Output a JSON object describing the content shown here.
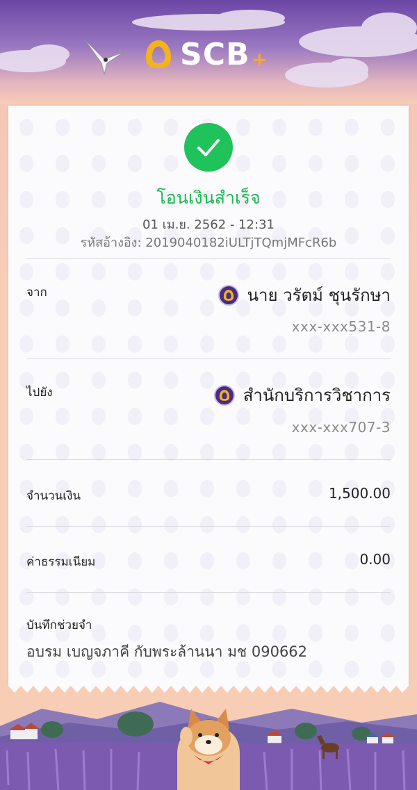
{
  "header": {
    "brand": "SCB",
    "brand_suffix": "+",
    "logo_icon": "scb-logo-icon",
    "bird_icon": "bird-icon"
  },
  "status": {
    "icon": "check-icon",
    "title": "โอนเงินสำเร็จ",
    "datetime": "01 เม.ย. 2562 - 12:31",
    "ref_label": "รหัสอ้างอิง:",
    "ref_code": "2019040182iULTjTQmjMFcR6b"
  },
  "from": {
    "label": "จาก",
    "name": "นาย วรัตม์ ชุนรักษา",
    "account": "xxx-xxx531-8"
  },
  "to": {
    "label": "ไปยัง",
    "name": "สำนักบริการวิชาการ",
    "account": "xxx-xxx707-3"
  },
  "amount": {
    "label": "จำนวนเงิน",
    "value": "1,500.00"
  },
  "fee": {
    "label": "ค่าธรรมเนียม",
    "value": "0.00"
  },
  "memo": {
    "label": "บันทึกช่วยจำ",
    "value": "อบรม เบญจภาคี กับพระล้านนา มช 090662"
  },
  "colors": {
    "success": "#1db954",
    "brand_purple": "#4b2c84",
    "background": "#f8cdb6"
  }
}
